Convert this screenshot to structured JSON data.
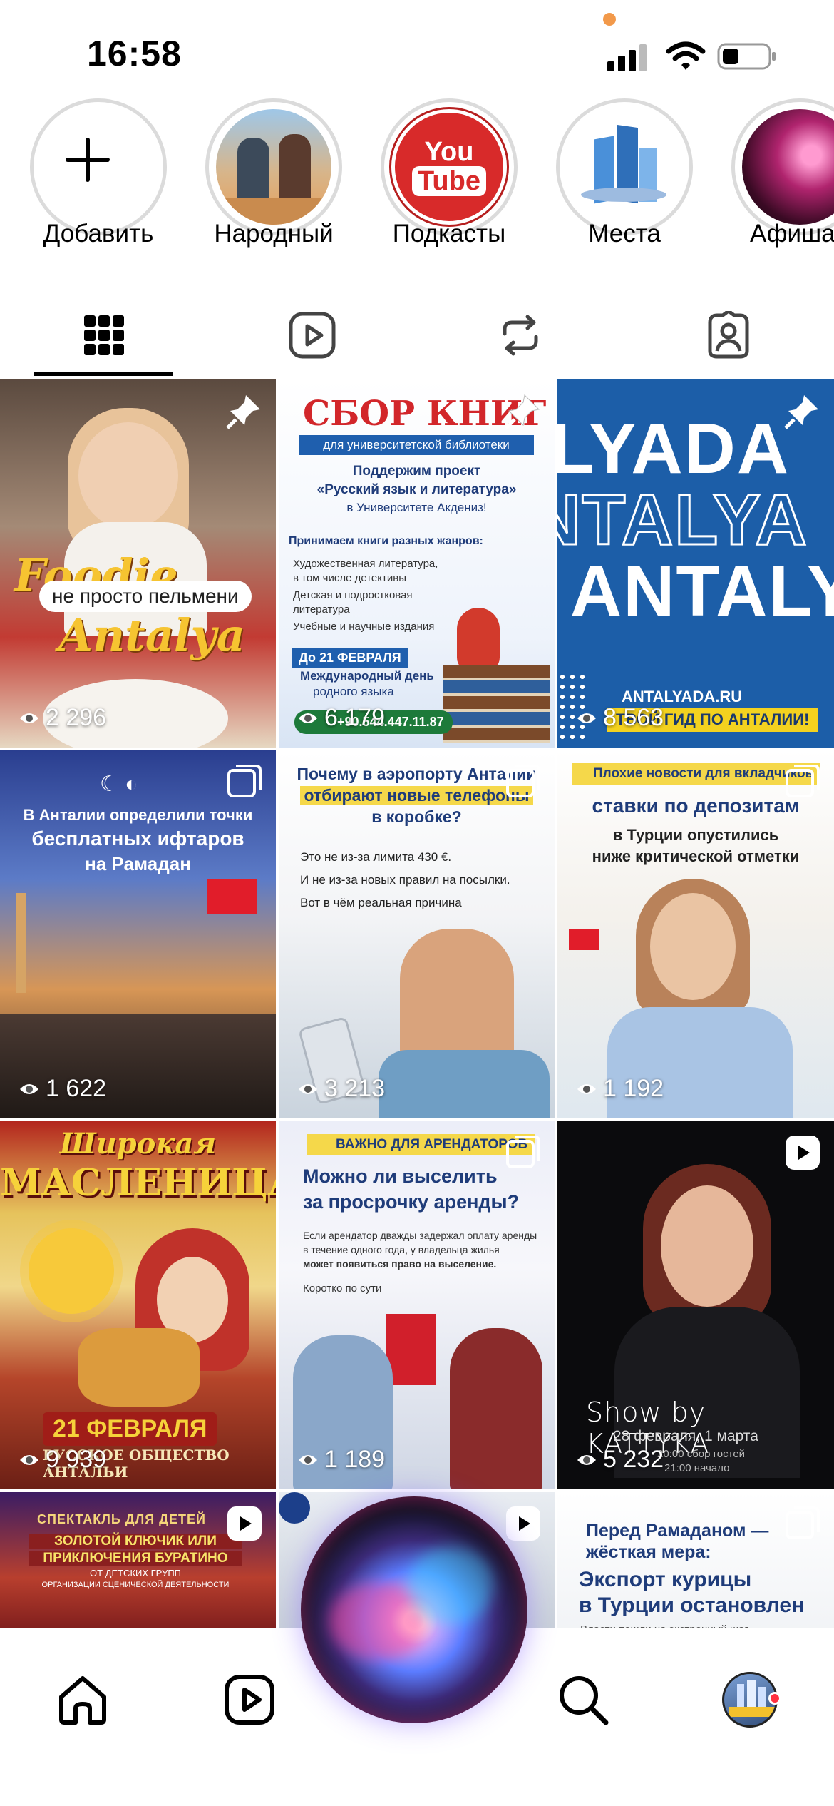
{
  "status": {
    "time": "16:58"
  },
  "highlights": [
    {
      "label": "Добавить",
      "icon": "plus-icon"
    },
    {
      "label": "Народный",
      "icon": "photo-cover"
    },
    {
      "label": "Подкасты",
      "icon": "youtube-cover",
      "cover_text": [
        "You",
        "Tube"
      ]
    },
    {
      "label": "Места",
      "icon": "city-cover"
    },
    {
      "label": "Афиша",
      "icon": "concert-cover"
    }
  ],
  "tabs": [
    {
      "name": "grid",
      "icon": "grid-icon",
      "active": true
    },
    {
      "name": "reels",
      "icon": "reels-icon"
    },
    {
      "name": "reposts",
      "icon": "repost-icon"
    },
    {
      "name": "tagged",
      "icon": "tagged-icon"
    }
  ],
  "posts": [
    {
      "views": "2 296",
      "badge": "pin",
      "text": [
        "Foodie",
        "не просто пельмени",
        "Antalya"
      ]
    },
    {
      "views": "6 179",
      "badge": "pin",
      "text": [
        "СБОР КНИГ",
        "для университетской библиотеки",
        "Поддержим проект",
        "«Русский язык и литература»",
        "в Университете Акдениз!",
        "Принимаем книги разных жанров:",
        "Художественная литература,",
        "в том числе детективы",
        "Детская и подростковая",
        "литература",
        "Учебные и научные издания",
        "До 21 ФЕВРАЛЯ",
        "Международный день",
        "родного языка",
        "+90.544.447.11.87"
      ]
    },
    {
      "views": "8 563",
      "badge": "pin",
      "text": [
        "LYADA",
        "NTALYA",
        "ANTALY",
        "ANTALYADA.RU",
        "ТВОЙ ГИД ПО АНТАЛИИ!"
      ]
    },
    {
      "views": "1 622",
      "badge": "carousel",
      "text": [
        "В Анталии определили точки",
        "бесплатных ифтаров",
        "на Рамадан"
      ]
    },
    {
      "views": "3 213",
      "badge": "carousel",
      "text": [
        "Почему в аэропорту Анталии",
        "отбирают новые телефоны",
        "в коробке?",
        "Это не из-за лимита 430 €.",
        "И не из-за новых правил на посылки.",
        "Вот в чём реальная причина"
      ]
    },
    {
      "views": "1 192",
      "badge": "carousel",
      "text": [
        "Плохие новости для вкладчиков",
        "ставки по депозитам",
        "в Турции опустились",
        "ниже критической отметки"
      ]
    },
    {
      "views": "9 939",
      "badge": "none",
      "text": [
        "Широкая",
        "МАСЛЕНИЦА!",
        "21 ФЕВРАЛЯ",
        "РУССКОЕ ОБЩЕСТВО АНТАЛЬИ"
      ]
    },
    {
      "views": "1 189",
      "badge": "carousel",
      "text": [
        "ВАЖНО ДЛЯ АРЕНДАТОРОВ",
        "Можно ли выселить",
        "за просрочку аренды?",
        "Если арендатор дважды задержал оплату аренды",
        "в течение одного года, у владельца жилья",
        "может появиться право на выселение.",
        "Коротко по сути"
      ]
    },
    {
      "views": "5 232",
      "badge": "reel",
      "text": [
        "Show by KATTYKA",
        "28 февраля, 1 марта",
        "20:00 сбор гостей",
        "21:00 начало"
      ]
    },
    {
      "views": "",
      "badge": "reel",
      "text": [
        "СПЕКТАКЛЬ ДЛЯ ДЕТЕЙ",
        "ЗОЛОТОЙ КЛЮЧИК ИЛИ",
        "ПРИКЛЮЧЕНИЯ БУРАТИНО",
        "ОТ ДЕТСКИХ ГРУПП",
        "ОРГАНИЗАЦИИ СЦЕНИЧЕСКОЙ ДЕЯТЕЛЬНОСТИ"
      ]
    },
    {
      "views": "",
      "badge": "reel",
      "text": []
    },
    {
      "views": "",
      "badge": "carousel",
      "text": [
        "Перед Рамаданом —",
        "жёсткая мера:",
        "Экспорт курицы",
        "в Турции остановлен",
        "Власти пошли на экстренный шаг"
      ]
    }
  ],
  "nav": [
    {
      "name": "home",
      "icon": "home-icon"
    },
    {
      "name": "reels",
      "icon": "reels-icon"
    },
    {
      "name": "siri",
      "icon": "siri-orb"
    },
    {
      "name": "search",
      "icon": "search-icon"
    },
    {
      "name": "profile",
      "icon": "profile-avatar",
      "notification": true
    }
  ],
  "colors": {
    "accent_underline": "#000000",
    "notification_dot": "#ff3040",
    "rec_dot": "#f2994a"
  }
}
